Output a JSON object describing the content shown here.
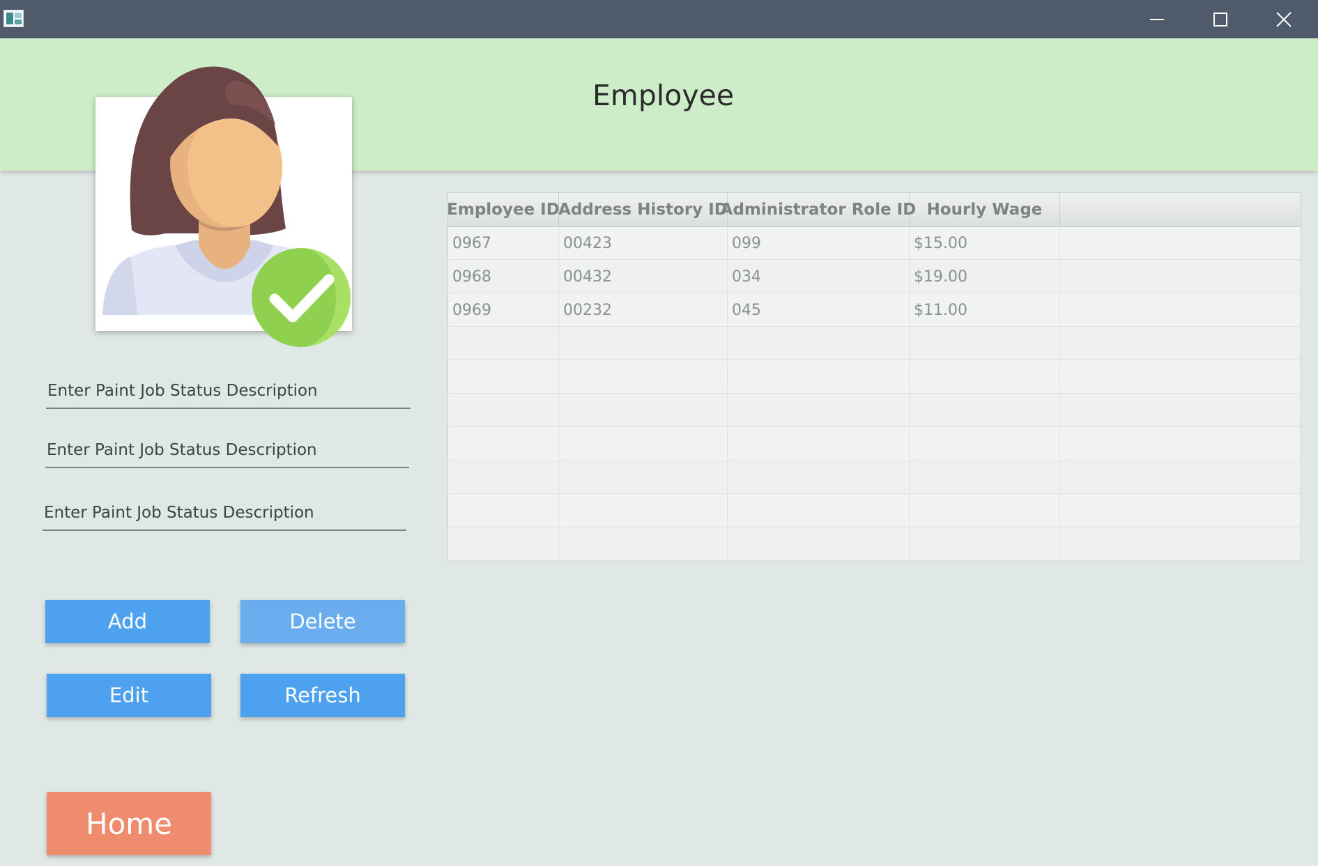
{
  "window": {
    "minimize_icon": "minimize-icon",
    "maximize_icon": "maximize-icon",
    "close_icon": "close-icon"
  },
  "header": {
    "title": "Employee"
  },
  "avatar": {
    "icon": "employee-avatar-icon",
    "badge_icon": "checkmark-icon",
    "badge_color": "#8fd14f"
  },
  "form": {
    "fields": [
      {
        "placeholder": "Enter Paint Job Status Description",
        "value": ""
      },
      {
        "placeholder": "Enter Paint Job Status Description",
        "value": ""
      },
      {
        "placeholder": "Enter Paint Job Status Description",
        "value": ""
      }
    ]
  },
  "buttons": {
    "add": "Add",
    "delete": "Delete",
    "edit": "Edit",
    "refresh": "Refresh",
    "home": "Home"
  },
  "table": {
    "columns": [
      "Employee ID",
      "Address History ID",
      "Administrator Role ID",
      "Hourly Wage"
    ],
    "rows": [
      [
        "0967",
        "00423",
        "099",
        "$15.00"
      ],
      [
        "0968",
        "00432",
        "034",
        "$19.00"
      ],
      [
        "0969",
        "00232",
        "045",
        "$11.00"
      ]
    ]
  },
  "colors": {
    "titlebar": "#4f5b6b",
    "header_band": "#cdedc8",
    "background": "#e0e8e6",
    "primary_button": "#4ea1ee",
    "home_button": "#ef8c6d"
  }
}
